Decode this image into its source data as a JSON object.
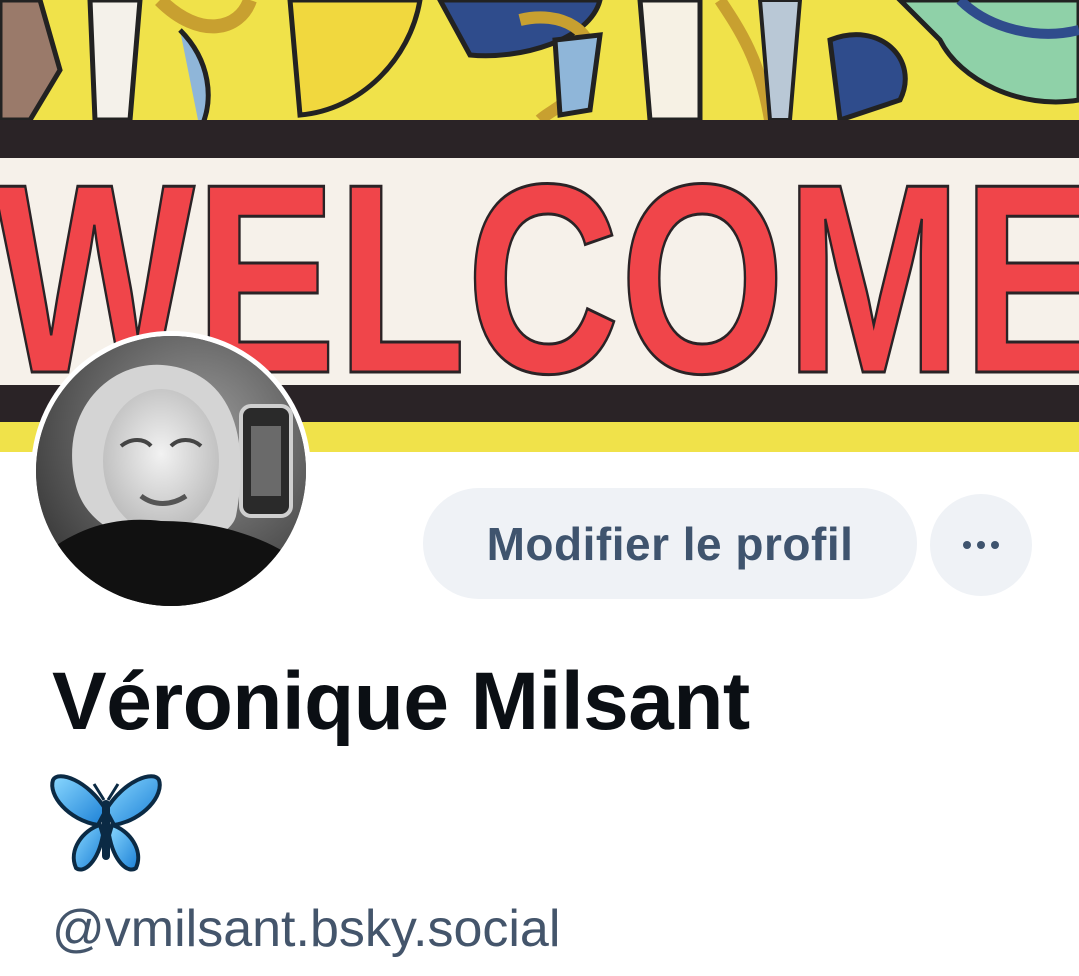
{
  "profile": {
    "display_name": "Véronique Milsant",
    "name_emoji": "butterfly-emoji",
    "handle": "@vmilsant.bsky.social",
    "banner_text": "WELCOME",
    "avatar": "profile-photo"
  },
  "actions": {
    "edit_profile_label": "Modifier le profil",
    "more_icon": "ellipsis-icon"
  },
  "colors": {
    "button_bg": "#eff2f6",
    "button_text": "#3f546e",
    "name_text": "#0b0f14",
    "handle_text": "#44556b",
    "banner_red": "#f0454a",
    "banner_yellow": "#f3e44a"
  }
}
